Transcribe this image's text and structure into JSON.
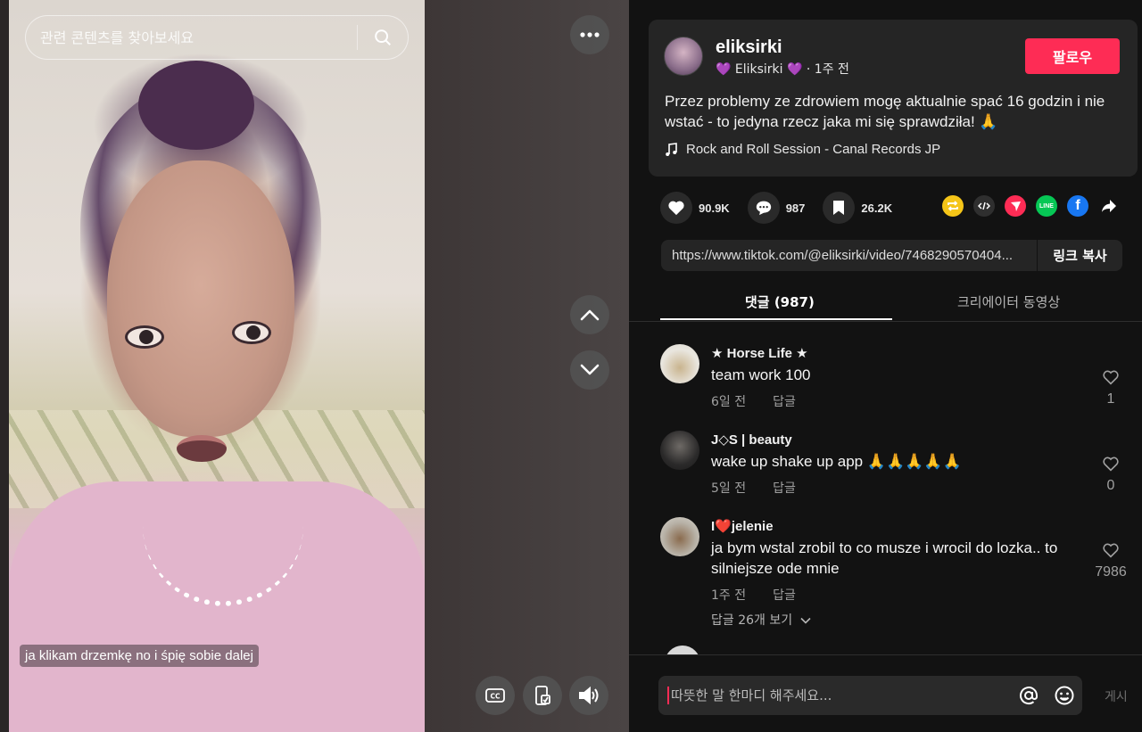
{
  "video": {
    "search_placeholder": "관련 콘텐츠를 찾아보세요",
    "caption": "ja klikam drzemkę no i śpię sobie dalej"
  },
  "post": {
    "username": "eliksirki",
    "nickname": "💜 Eliksirki 💜",
    "time": "1주 전",
    "follow_label": "팔로우",
    "description": "Przez problemy ze zdrowiem mogę aktualnie spać 16 godzin i nie wstać - to jedyna rzecz jaka mi się sprawdziła! 🙏",
    "music": "Rock and Roll Session - Canal Records JP"
  },
  "stats": {
    "likes": "90.9K",
    "comments": "987",
    "saves": "26.2K"
  },
  "share_icons": [
    {
      "name": "repost-icon",
      "color": "#f5c518"
    },
    {
      "name": "embed-icon",
      "color": "#2f2f2f"
    },
    {
      "name": "send-icon",
      "color": "#fe2c55"
    },
    {
      "name": "line-icon",
      "color": "#06c755",
      "label": "LINE"
    },
    {
      "name": "facebook-icon",
      "color": "#1877f2",
      "label": "f"
    },
    {
      "name": "share-arrow-icon",
      "color": "transparent"
    }
  ],
  "link": {
    "url": "https://www.tiktok.com/@eliksirki/video/7468290570404...",
    "copy_label": "링크 복사"
  },
  "tabs": {
    "comments": "댓글 (987)",
    "creator_videos": "크리에이터 동영상"
  },
  "comments": [
    {
      "name": "★ Horse Life ★",
      "text": "team work 100",
      "time": "6일 전",
      "reply": "답글",
      "likes": "1"
    },
    {
      "name": "J◇S | beauty",
      "text": "wake up shake up app 🙏🙏🙏🙏🙏",
      "time": "5일 전",
      "reply": "답글",
      "likes": "0"
    },
    {
      "name": "I❤️jelenie",
      "text": "ja bym wstal zrobil to co musze i wrocil do lozka.. to silniejsze ode mnie",
      "time": "1주 전",
      "reply": "답글",
      "likes": "7986",
      "more_replies": "답글 26개 보기"
    }
  ],
  "comment_input": {
    "placeholder": "따뜻한 말 한마디 해주세요...",
    "post_label": "게시"
  },
  "colors": {
    "accent": "#fe2c55",
    "background": "#121212",
    "card": "#252525"
  }
}
